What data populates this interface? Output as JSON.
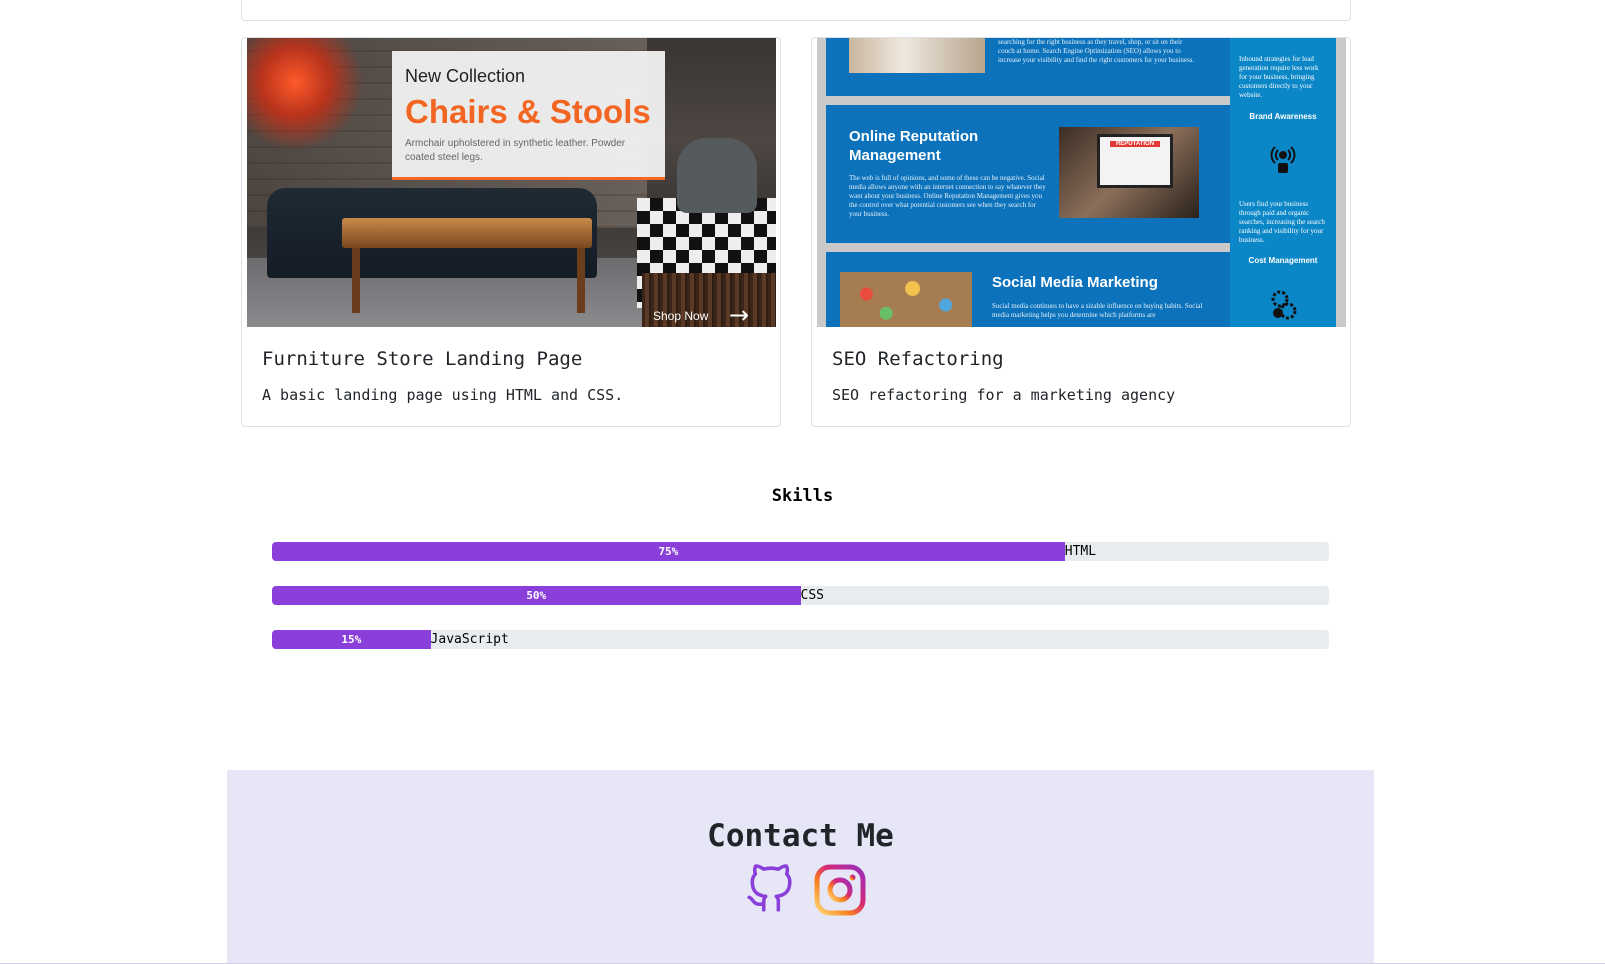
{
  "projects": [
    {
      "title": "Furniture Store Landing Page",
      "description": "A basic landing page using HTML and CSS.",
      "image": {
        "line1": "New Collection",
        "line2": "Chairs & Stools",
        "line3": "Armchair upholstered in synthetic leather. Powder coated steel legs.",
        "cta": "Shop Now"
      }
    },
    {
      "title": "SEO Refactoring",
      "description": "SEO refactoring for a marketing agency",
      "image": {
        "top_text": "searching for the right business as they travel, shop, or sit on their couch at home. Search Engine Optimization (SEO) allows you to increase your visibility and find the right customers for your business.",
        "heading1": "Online Reputation Management",
        "para1": "The web is full of opinions, and some of these can be negative. Social media allows anyone with an internet connection to say whatever they want about your business. Online Reputation Management gives you the control over what potential customers see when they search for your business.",
        "heading2": "Social Media Marketing",
        "para2": "Social media continues to have a sizable influence on buying habits. Social media marketing helps you determine which platforms are",
        "side_text1": "Inbound strategies for lead generation require less work for your business, bringing customers directly to your website.",
        "side_heading1": "Brand Awareness",
        "side_text2": "Users find your business through paid and organic searches, increasing the search ranking and visibility for your business.",
        "side_heading2": "Cost Management",
        "screen_label": "REPUTATION"
      }
    }
  ],
  "skills": {
    "title": "Skills",
    "items": [
      {
        "name": "HTML",
        "percent": 75,
        "label": "75%"
      },
      {
        "name": "CSS",
        "percent": 50,
        "label": "50%"
      },
      {
        "name": "JavaScript",
        "percent": 15,
        "label": "15%"
      }
    ],
    "bar_color": "#8a3fdb",
    "track_color": "#e9ecef"
  },
  "contact": {
    "title": "Contact Me",
    "links": [
      {
        "icon": "github-icon",
        "color": "#8a3fdb"
      },
      {
        "icon": "instagram-icon",
        "colors": [
          "#feda75",
          "#d62976",
          "#962fbf"
        ]
      }
    ],
    "background": "#e6e6f7"
  }
}
